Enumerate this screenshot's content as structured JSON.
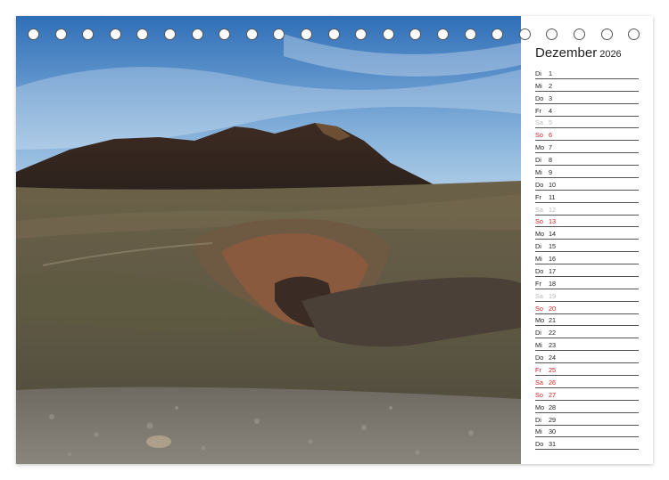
{
  "calendar": {
    "month": "Dezember",
    "year": "2026",
    "days": [
      {
        "wd": "Di",
        "d": "1",
        "t": "n"
      },
      {
        "wd": "Mi",
        "d": "2",
        "t": "n"
      },
      {
        "wd": "Do",
        "d": "3",
        "t": "n"
      },
      {
        "wd": "Fr",
        "d": "4",
        "t": "n"
      },
      {
        "wd": "Sa",
        "d": "5",
        "t": "sat"
      },
      {
        "wd": "So",
        "d": "6",
        "t": "sun"
      },
      {
        "wd": "Mo",
        "d": "7",
        "t": "n"
      },
      {
        "wd": "Di",
        "d": "8",
        "t": "n"
      },
      {
        "wd": "Mi",
        "d": "9",
        "t": "n"
      },
      {
        "wd": "Do",
        "d": "10",
        "t": "n"
      },
      {
        "wd": "Fr",
        "d": "11",
        "t": "n"
      },
      {
        "wd": "Sa",
        "d": "12",
        "t": "sat"
      },
      {
        "wd": "So",
        "d": "13",
        "t": "sun"
      },
      {
        "wd": "Mo",
        "d": "14",
        "t": "n"
      },
      {
        "wd": "Di",
        "d": "15",
        "t": "n"
      },
      {
        "wd": "Mi",
        "d": "16",
        "t": "n"
      },
      {
        "wd": "Do",
        "d": "17",
        "t": "n"
      },
      {
        "wd": "Fr",
        "d": "18",
        "t": "n"
      },
      {
        "wd": "Sa",
        "d": "19",
        "t": "sat"
      },
      {
        "wd": "So",
        "d": "20",
        "t": "sun"
      },
      {
        "wd": "Mo",
        "d": "21",
        "t": "n"
      },
      {
        "wd": "Di",
        "d": "22",
        "t": "n"
      },
      {
        "wd": "Mi",
        "d": "23",
        "t": "n"
      },
      {
        "wd": "Do",
        "d": "24",
        "t": "n"
      },
      {
        "wd": "Fr",
        "d": "25",
        "t": "hol"
      },
      {
        "wd": "Sa",
        "d": "26",
        "t": "hol"
      },
      {
        "wd": "So",
        "d": "27",
        "t": "sun"
      },
      {
        "wd": "Mo",
        "d": "28",
        "t": "n"
      },
      {
        "wd": "Di",
        "d": "29",
        "t": "n"
      },
      {
        "wd": "Mi",
        "d": "30",
        "t": "n"
      },
      {
        "wd": "Do",
        "d": "31",
        "t": "n"
      }
    ]
  },
  "colors": {
    "holiday": "#d62020",
    "saturday": "#b8b8b8",
    "text": "#222222"
  },
  "photo": {
    "subject": "volcanic-crater-landscape"
  }
}
